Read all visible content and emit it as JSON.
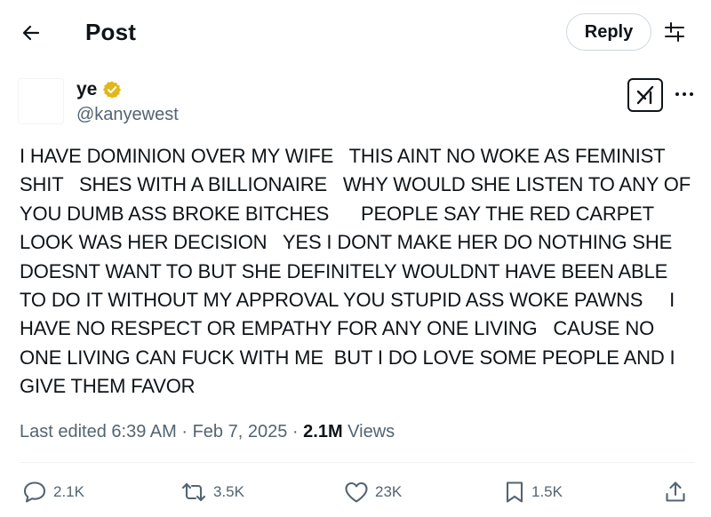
{
  "header": {
    "title": "Post",
    "reply_label": "Reply",
    "back_icon": "arrow-left-icon",
    "settings_icon": "sliders-icon"
  },
  "author": {
    "display_name": "ye",
    "handle": "@kanyewest",
    "verified": true,
    "verified_color": "#e2b719"
  },
  "post": {
    "text": "I HAVE DOMINION OVER MY WIFE   THIS AINT NO WOKE AS FEMINIST\nSHIT   SHES WITH A BILLIONAIRE   WHY WOULD SHE LISTEN TO ANY OF\nYOU DUMB ASS BROKE BITCHES      PEOPLE SAY THE RED CARPET\nLOOK WAS HER DECISION   YES I DONT MAKE HER DO NOTHING SHE\nDOESNT WANT TO BUT SHE DEFINITELY WOULDNT HAVE BEEN ABLE\nTO DO IT WITHOUT MY APPROVAL YOU STUPID ASS WOKE PAWNS     I\nHAVE NO RESPECT OR EMPATHY FOR ANY ONE LIVING   CAUSE NO\nONE LIVING CAN FUCK WITH ME  BUT I DO LOVE SOME PEOPLE AND I\nGIVE THEM FAVOR"
  },
  "meta": {
    "edited": "Last edited 6:39 AM",
    "separator": "·",
    "date": "Feb 7, 2025",
    "views_count": "2.1M",
    "views_label": "Views"
  },
  "actions": {
    "replies": "2.1K",
    "reposts": "3.5K",
    "likes": "23K",
    "bookmarks": "1.5K"
  },
  "colors": {
    "text": "#0f1419",
    "secondary": "#536471",
    "border": "#cfd9de"
  }
}
